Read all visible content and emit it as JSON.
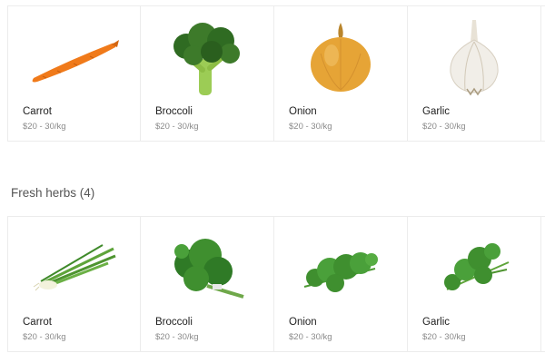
{
  "vegetables": {
    "items": [
      {
        "name": "Carrot",
        "price": "$20 - 30/kg",
        "icon": "carrot-image"
      },
      {
        "name": "Broccoli",
        "price": "$20 - 30/kg",
        "icon": "broccoli-image"
      },
      {
        "name": "Onion",
        "price": "$20 - 30/kg",
        "icon": "onion-image"
      },
      {
        "name": "Garlic",
        "price": "$20 - 30/kg",
        "icon": "garlic-image"
      }
    ]
  },
  "herbs": {
    "title": "Fresh herbs (4)",
    "items": [
      {
        "name": "Carrot",
        "price": "$20 - 30/kg",
        "icon": "spring-onion-image"
      },
      {
        "name": "Broccoli",
        "price": "$20 - 30/kg",
        "icon": "cilantro-bunch-image"
      },
      {
        "name": "Onion",
        "price": "$20 - 30/kg",
        "icon": "parsley-image"
      },
      {
        "name": "Garlic",
        "price": "$20 - 30/kg",
        "icon": "celery-leaves-image"
      }
    ]
  },
  "colors": {
    "carrot": "#f07a1a",
    "broccoli": "#3d7a2a",
    "onion": "#e6a436",
    "garlic": "#f1eee8",
    "herb": "#3f8f2f"
  }
}
